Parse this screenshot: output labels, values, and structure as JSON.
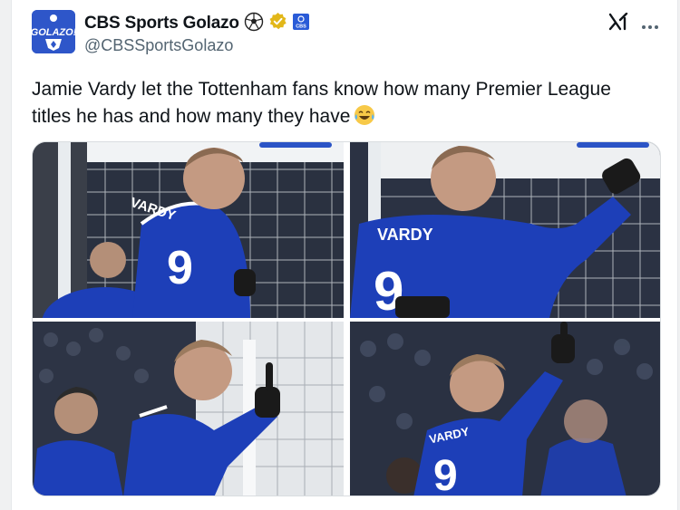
{
  "account": {
    "display_name": "CBS Sports Golazo",
    "handle": "@CBSSportsGolazo",
    "avatar_text": "GOLAZO!",
    "badge_text": "CBS"
  },
  "tweet": {
    "text": "Jamie Vardy let the Tottenham fans know how many Premier League titles he has and how many they have"
  },
  "media": {
    "shirt_name": "VARDY",
    "shirt_number": "9"
  },
  "colors": {
    "leicester_blue": "#1d3fb8",
    "verified_gold": "#e2b719",
    "badge_blue": "#2a5bd7"
  }
}
